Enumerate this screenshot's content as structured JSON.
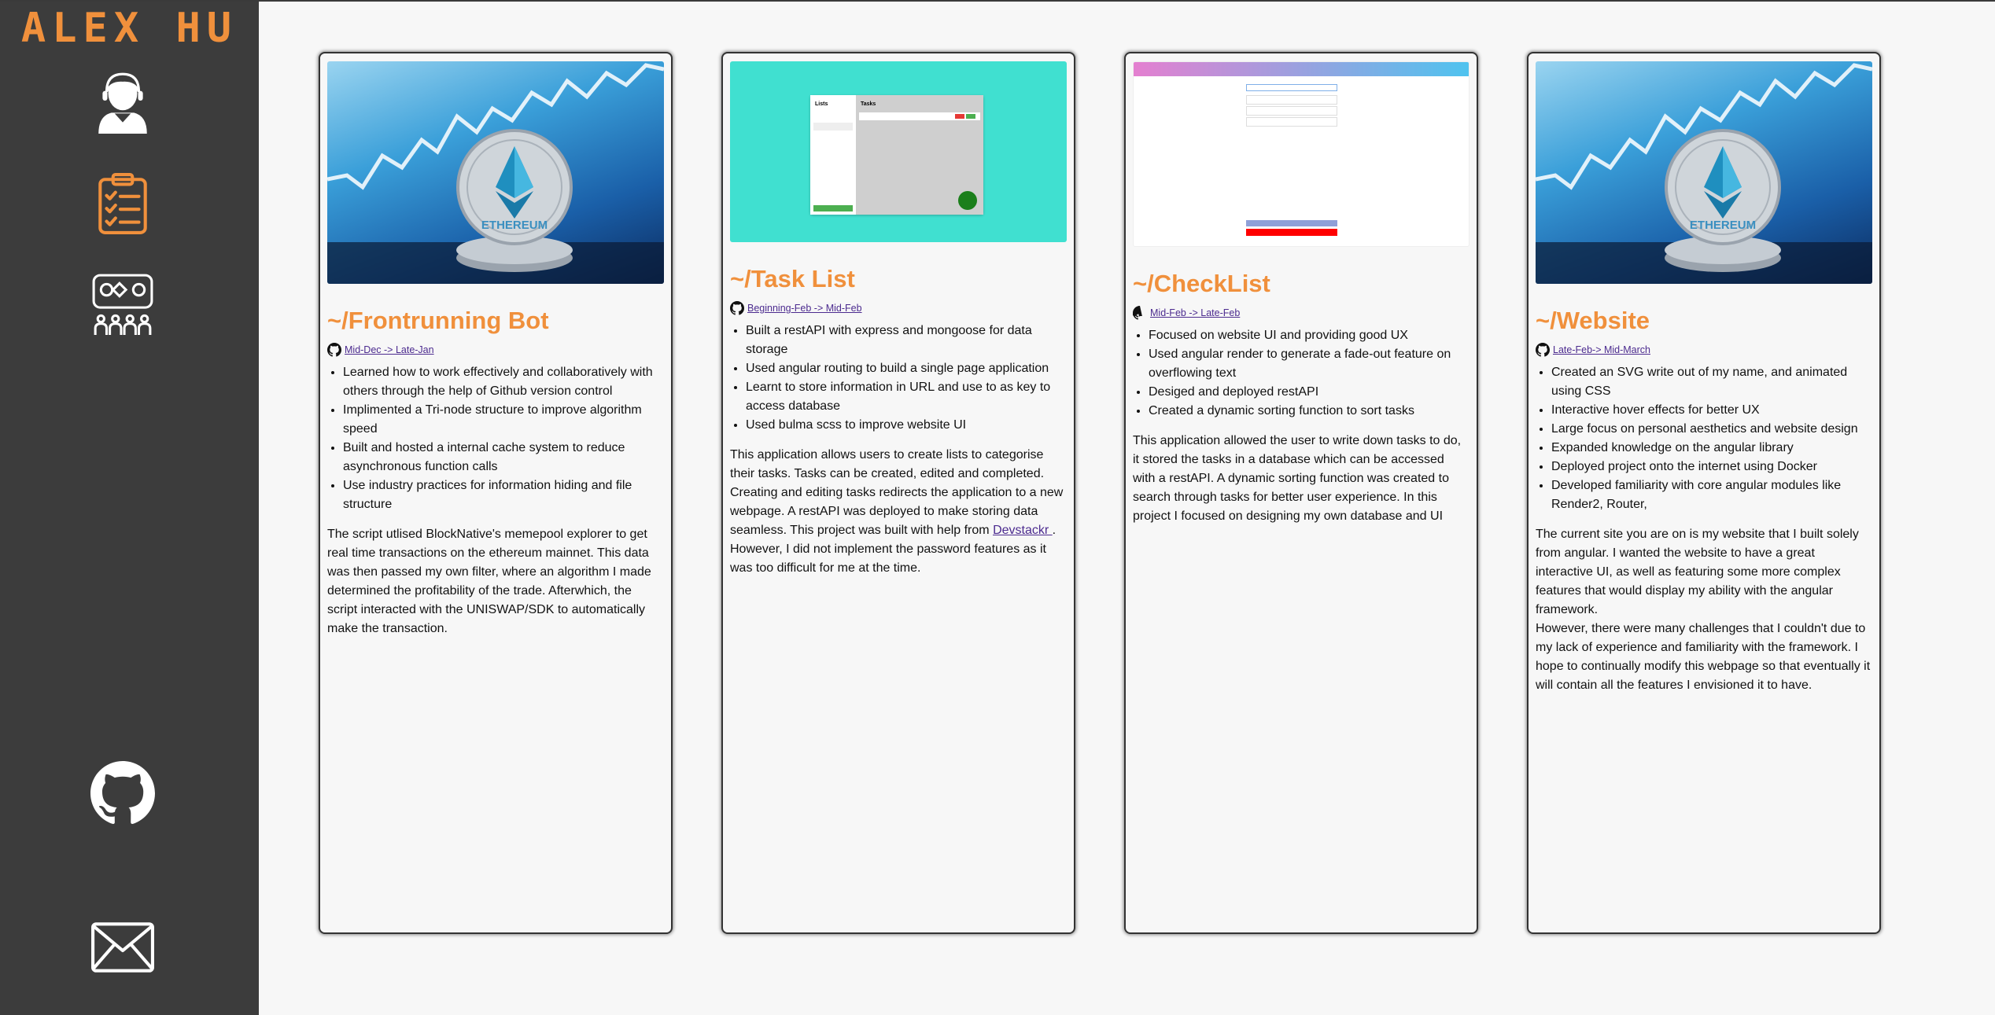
{
  "sidebar": {
    "logo": "ALEX HU",
    "icons": [
      "user-avatar-icon",
      "clipboard-checklist-icon",
      "skills-team-icon",
      "github-icon",
      "mail-icon"
    ],
    "accent": "#f0903c",
    "background": "#3c3c3c"
  },
  "projects": [
    {
      "title": "~/Frontrunning Bot",
      "dates": " Mid-Dec -> Late-Jan",
      "image_text": "ETHEREUM",
      "features": [
        "Learned how to work effectively and collaboratively with others through the help of Github version control",
        "Implimented a Tri-node structure to improve algorithm speed",
        "Built and hosted a internal cache system to reduce asynchronous function calls",
        "Use industry practices for information hiding and file structure"
      ],
      "description": "The script utlised BlockNative's memepool explorer to get real time transactions on the ethereum mainnet. This data was then passed my own filter, where an algorithm I made determined the profitability of the trade. Afterwhich, the script interacted with the UNISWAP/SDK to automatically make the transaction."
    },
    {
      "title": "~/Task List",
      "dates": " Beginning-Feb -> Mid-Feb",
      "thumb": {
        "lists_label": "Lists",
        "tasks_label": "Tasks"
      },
      "features": [
        "Built a restAPI with express and mongoose for data storage",
        "Used angular routing to build a single page application",
        "Learnt to store information in URL and use to as key to access database",
        "Used bulma scss to improve website UI"
      ],
      "description_before": "This application allows users to create lists to categorise their tasks. Tasks can be created, edited and completed. Creating and editing tasks redirects the application to a new webpage. A restAPI was deployed to make storing data seamless. This project was built with help from ",
      "description_link": "Devstackr ",
      "description_after": ". However, I did not implement the password features as it was too difficult for me at the time."
    },
    {
      "title": "~/CheckList",
      "dates": " Mid-Feb -> Late-Feb",
      "features": [
        "Focused on website UI and providing good UX",
        "Used angular render to generate a fade-out feature on overflowing text",
        "Desiged and deployed restAPI",
        "Created a dynamic sorting function to sort tasks"
      ],
      "description": "This application allowed the user to write down tasks to do, it stored the tasks in a database which can be accessed with a restAPI. A dynamic sorting function was created to search through tasks for better user experience. In this project I focused on designing my own database and UI"
    },
    {
      "title": "~/Website",
      "dates": " Late-Feb-> Mid-March",
      "image_text": "ETHEREUM",
      "features": [
        "Created an SVG write out of my name, and animated using CSS",
        "Interactive hover effects for better UX",
        "Large focus on personal aesthetics and website design",
        "Expanded knowledge on the angular library",
        "Deployed project onto the internet using Docker",
        "Developed familiarity with core angular modules like Render2, Router,"
      ],
      "description": "The current site you are on is my website that I built solely from angular. I wanted the website to have a great interactive UI, as well as featuring some more complex features that would display my ability with the angular framework.",
      "description2": "However, there were many challenges that I couldn't due to my lack of experience and familiarity with the framework. I hope to continually modify this webpage so that eventually it will contain all the features I envisioned it to have."
    }
  ]
}
